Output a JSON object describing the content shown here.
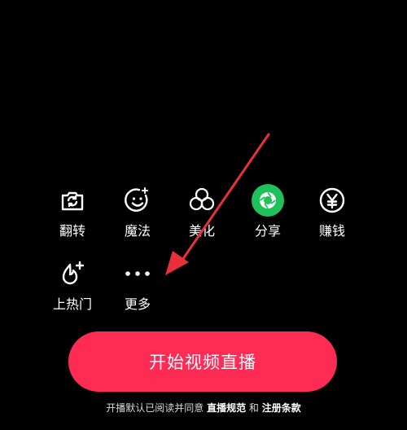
{
  "colors": {
    "background": "#000000",
    "accent": "#fe2c55",
    "share_green": "#1fc25a",
    "annotation_arrow": "#e8303a"
  },
  "tools": [
    {
      "label": "翻转",
      "icon": "camera-flip-icon"
    },
    {
      "label": "魔法",
      "icon": "magic-face-icon"
    },
    {
      "label": "美化",
      "icon": "beautify-petals-icon"
    },
    {
      "label": "分享",
      "icon": "share-shutter-icon"
    },
    {
      "label": "赚钱",
      "icon": "yen-coin-icon"
    },
    {
      "label": "上热门",
      "icon": "flame-plus-icon"
    },
    {
      "label": "更多",
      "icon": "more-dots-icon"
    }
  ],
  "start_button": {
    "label": "开始视频直播"
  },
  "agreement": {
    "prefix": "开播默认已阅读并同意",
    "link1": "直播规范",
    "and": "和",
    "link2": "注册条款"
  }
}
